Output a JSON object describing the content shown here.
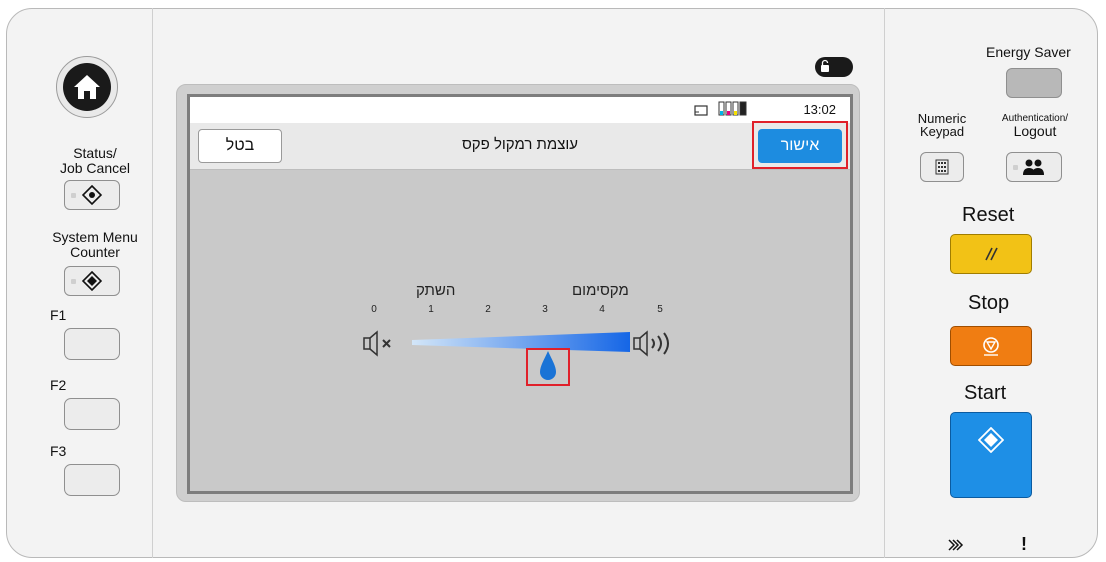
{
  "left": {
    "status_label_1": "Status/",
    "status_label_2": "Job Cancel",
    "system_menu_label_1": "System Menu",
    "system_menu_label_2": "Counter",
    "f1": "F1",
    "f2": "F2",
    "f3": "F3"
  },
  "screen": {
    "clock": "13:02",
    "title": "עוצמת רמקול פקס",
    "cancel_label": "בטל",
    "ok_label": "אישור",
    "mute_label": "השתק",
    "max_label": "מקסימום",
    "ticks": [
      "0",
      "1",
      "2",
      "3",
      "4",
      "5"
    ],
    "volume_value": 3
  },
  "right": {
    "energy_saver": "Energy Saver",
    "numeric_keypad_1": "Numeric",
    "numeric_keypad_2": "Keypad",
    "auth_1": "Authentication/",
    "auth_2": "Logout",
    "reset": "Reset",
    "stop": "Stop",
    "start": "Start",
    "indicator_exclaim": "!"
  },
  "colors": {
    "accent_blue": "#1d8ce0",
    "reset_yellow": "#f2c216",
    "stop_orange": "#f07d12",
    "start_blue": "#1e8fe6",
    "highlight_red": "#e0202a"
  }
}
